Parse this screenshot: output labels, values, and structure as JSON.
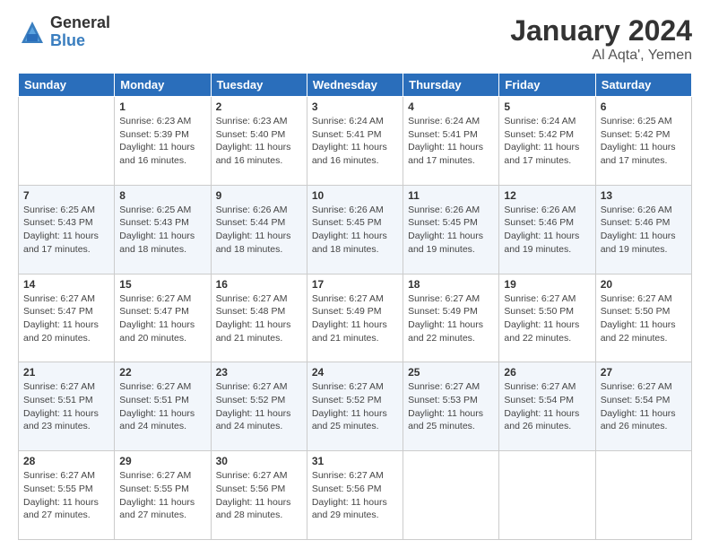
{
  "logo": {
    "general": "General",
    "blue": "Blue"
  },
  "title": "January 2024",
  "location": "Al Aqta', Yemen",
  "days_of_week": [
    "Sunday",
    "Monday",
    "Tuesday",
    "Wednesday",
    "Thursday",
    "Friday",
    "Saturday"
  ],
  "weeks": [
    [
      {
        "day": null,
        "info": null
      },
      {
        "day": "1",
        "info": "Sunrise: 6:23 AM\nSunset: 5:39 PM\nDaylight: 11 hours\nand 16 minutes."
      },
      {
        "day": "2",
        "info": "Sunrise: 6:23 AM\nSunset: 5:40 PM\nDaylight: 11 hours\nand 16 minutes."
      },
      {
        "day": "3",
        "info": "Sunrise: 6:24 AM\nSunset: 5:41 PM\nDaylight: 11 hours\nand 16 minutes."
      },
      {
        "day": "4",
        "info": "Sunrise: 6:24 AM\nSunset: 5:41 PM\nDaylight: 11 hours\nand 17 minutes."
      },
      {
        "day": "5",
        "info": "Sunrise: 6:24 AM\nSunset: 5:42 PM\nDaylight: 11 hours\nand 17 minutes."
      },
      {
        "day": "6",
        "info": "Sunrise: 6:25 AM\nSunset: 5:42 PM\nDaylight: 11 hours\nand 17 minutes."
      }
    ],
    [
      {
        "day": "7",
        "info": "Sunrise: 6:25 AM\nSunset: 5:43 PM\nDaylight: 11 hours\nand 17 minutes."
      },
      {
        "day": "8",
        "info": "Sunrise: 6:25 AM\nSunset: 5:43 PM\nDaylight: 11 hours\nand 18 minutes."
      },
      {
        "day": "9",
        "info": "Sunrise: 6:26 AM\nSunset: 5:44 PM\nDaylight: 11 hours\nand 18 minutes."
      },
      {
        "day": "10",
        "info": "Sunrise: 6:26 AM\nSunset: 5:45 PM\nDaylight: 11 hours\nand 18 minutes."
      },
      {
        "day": "11",
        "info": "Sunrise: 6:26 AM\nSunset: 5:45 PM\nDaylight: 11 hours\nand 19 minutes."
      },
      {
        "day": "12",
        "info": "Sunrise: 6:26 AM\nSunset: 5:46 PM\nDaylight: 11 hours\nand 19 minutes."
      },
      {
        "day": "13",
        "info": "Sunrise: 6:26 AM\nSunset: 5:46 PM\nDaylight: 11 hours\nand 19 minutes."
      }
    ],
    [
      {
        "day": "14",
        "info": "Sunrise: 6:27 AM\nSunset: 5:47 PM\nDaylight: 11 hours\nand 20 minutes."
      },
      {
        "day": "15",
        "info": "Sunrise: 6:27 AM\nSunset: 5:47 PM\nDaylight: 11 hours\nand 20 minutes."
      },
      {
        "day": "16",
        "info": "Sunrise: 6:27 AM\nSunset: 5:48 PM\nDaylight: 11 hours\nand 21 minutes."
      },
      {
        "day": "17",
        "info": "Sunrise: 6:27 AM\nSunset: 5:49 PM\nDaylight: 11 hours\nand 21 minutes."
      },
      {
        "day": "18",
        "info": "Sunrise: 6:27 AM\nSunset: 5:49 PM\nDaylight: 11 hours\nand 22 minutes."
      },
      {
        "day": "19",
        "info": "Sunrise: 6:27 AM\nSunset: 5:50 PM\nDaylight: 11 hours\nand 22 minutes."
      },
      {
        "day": "20",
        "info": "Sunrise: 6:27 AM\nSunset: 5:50 PM\nDaylight: 11 hours\nand 22 minutes."
      }
    ],
    [
      {
        "day": "21",
        "info": "Sunrise: 6:27 AM\nSunset: 5:51 PM\nDaylight: 11 hours\nand 23 minutes."
      },
      {
        "day": "22",
        "info": "Sunrise: 6:27 AM\nSunset: 5:51 PM\nDaylight: 11 hours\nand 24 minutes."
      },
      {
        "day": "23",
        "info": "Sunrise: 6:27 AM\nSunset: 5:52 PM\nDaylight: 11 hours\nand 24 minutes."
      },
      {
        "day": "24",
        "info": "Sunrise: 6:27 AM\nSunset: 5:52 PM\nDaylight: 11 hours\nand 25 minutes."
      },
      {
        "day": "25",
        "info": "Sunrise: 6:27 AM\nSunset: 5:53 PM\nDaylight: 11 hours\nand 25 minutes."
      },
      {
        "day": "26",
        "info": "Sunrise: 6:27 AM\nSunset: 5:54 PM\nDaylight: 11 hours\nand 26 minutes."
      },
      {
        "day": "27",
        "info": "Sunrise: 6:27 AM\nSunset: 5:54 PM\nDaylight: 11 hours\nand 26 minutes."
      }
    ],
    [
      {
        "day": "28",
        "info": "Sunrise: 6:27 AM\nSunset: 5:55 PM\nDaylight: 11 hours\nand 27 minutes."
      },
      {
        "day": "29",
        "info": "Sunrise: 6:27 AM\nSunset: 5:55 PM\nDaylight: 11 hours\nand 27 minutes."
      },
      {
        "day": "30",
        "info": "Sunrise: 6:27 AM\nSunset: 5:56 PM\nDaylight: 11 hours\nand 28 minutes."
      },
      {
        "day": "31",
        "info": "Sunrise: 6:27 AM\nSunset: 5:56 PM\nDaylight: 11 hours\nand 29 minutes."
      },
      {
        "day": null,
        "info": null
      },
      {
        "day": null,
        "info": null
      },
      {
        "day": null,
        "info": null
      }
    ]
  ]
}
